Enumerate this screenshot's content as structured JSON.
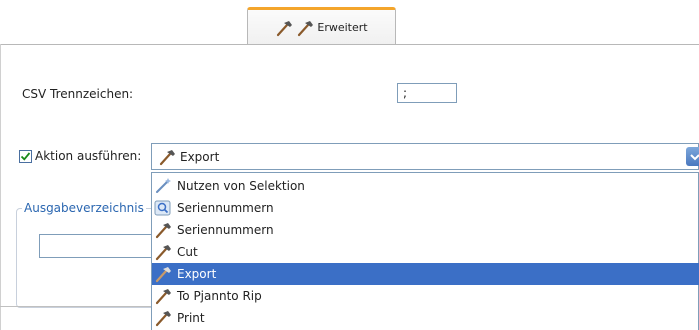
{
  "tab": {
    "label": "Erweitert",
    "active_color": "#f4a52b"
  },
  "csv": {
    "label": "CSV Trennzeichen:",
    "value": ";"
  },
  "action": {
    "checkbox_checked": true,
    "label": "Aktion ausführen:",
    "selected": "Export"
  },
  "group": {
    "legend": "Ausgabeverzeichnis"
  },
  "dropdown": {
    "selection_color": "#3b6fc6",
    "items": [
      {
        "label": "Nutzen von Selektion",
        "icon": "wand-icon"
      },
      {
        "label": "Seriennummern",
        "icon": "magnifier-icon"
      },
      {
        "label": "Seriennummern",
        "icon": "hammer-icon"
      },
      {
        "label": "Cut",
        "icon": "hammer-icon"
      },
      {
        "label": "Export",
        "icon": "hammer-icon",
        "selected": true
      },
      {
        "label": "To Pjannto Rip",
        "icon": "hammer-icon"
      },
      {
        "label": "Print",
        "icon": "hammer-icon"
      }
    ]
  }
}
